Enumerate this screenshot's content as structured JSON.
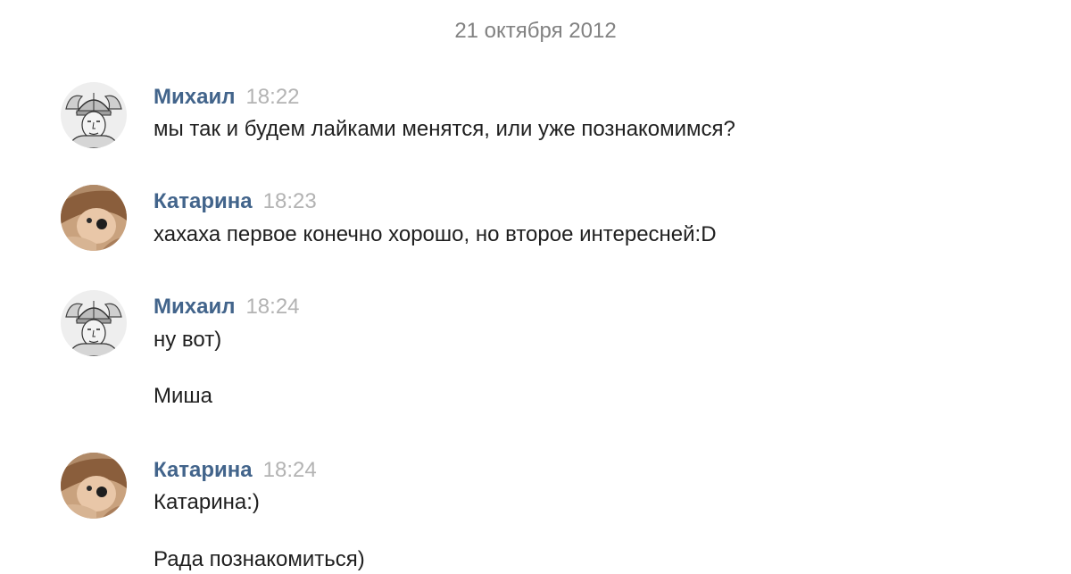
{
  "date_divider": "21 октября 2012",
  "messages": [
    {
      "author": "Михаил",
      "time": "18:22",
      "avatar_icon": "viking-helmet-portrait-avatar",
      "lines": [
        "мы так и будем лайками менятся, или уже познакомимся?"
      ]
    },
    {
      "author": "Катарина",
      "time": "18:23",
      "avatar_icon": "woman-with-sunglasses-photo-avatar",
      "lines": [
        "хахаха первое конечно хорошо, но второе интересней:D"
      ]
    },
    {
      "author": "Михаил",
      "time": "18:24",
      "avatar_icon": "viking-helmet-portrait-avatar",
      "lines": [
        "ну вот)",
        "Миша"
      ]
    },
    {
      "author": "Катарина",
      "time": "18:24",
      "avatar_icon": "woman-with-sunglasses-photo-avatar",
      "lines": [
        "Катарина:)",
        "Рада познакомиться)"
      ]
    }
  ],
  "colors": {
    "author": "#42648b",
    "time": "#b3b3b3",
    "text": "#1f1f1f",
    "date": "#828282"
  }
}
